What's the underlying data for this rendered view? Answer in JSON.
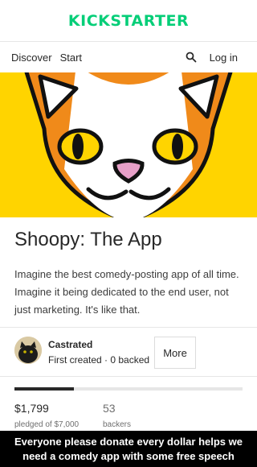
{
  "header": {
    "logo_text": "KICKSTARTER",
    "brand_color": "#05ce78"
  },
  "nav": {
    "discover": "Discover",
    "start": "Start",
    "search_icon": "search-icon",
    "login": "Log in"
  },
  "project": {
    "title": "Shoopy: The App",
    "description": "Imagine the best comedy-posting app of all time. Imagine it being dedicated to the end user, not just marketing. It's like that.",
    "hero_colors": {
      "background": "#ffd400",
      "orange": "#f08a1a",
      "nose": "#e7a0c8"
    }
  },
  "creator": {
    "name": "Castrated",
    "meta": "First created · 0 backed",
    "more_label": "More"
  },
  "funding": {
    "progress_fraction": 0.26,
    "pledged": "$1,799",
    "pledged_label": "pledged of $7,000",
    "backers": "53",
    "backers_label": "backers"
  },
  "caption": {
    "line1": "Everyone please donate every dollar helps we",
    "line2": "need a comedy app with some free speech"
  }
}
